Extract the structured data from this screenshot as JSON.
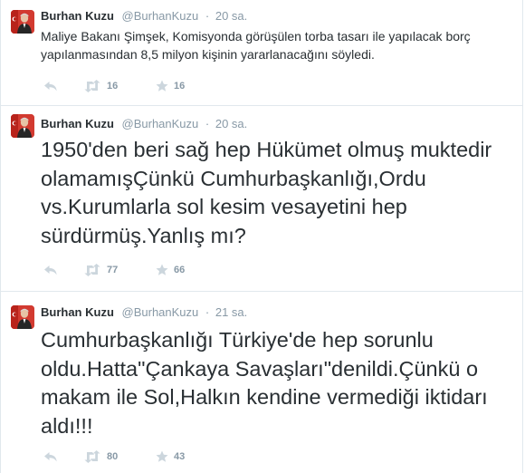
{
  "tweets": [
    {
      "fullname": "Burhan Kuzu",
      "username": "@BurhanKuzu",
      "separator": "·",
      "time": "20 sa.",
      "text": "Maliye Bakanı Şimşek, Komisyonda görüşülen torba tasarı ile yapılacak borç yapılanmasından 8,5 milyon kişinin yararlanacağını söyledi.",
      "retweets": "16",
      "favorites": "16"
    },
    {
      "fullname": "Burhan Kuzu",
      "username": "@BurhanKuzu",
      "separator": "·",
      "time": "20 sa.",
      "text": "1950'den beri sağ hep Hükümet olmuş muktedir olamamışÇünkü Cumhurbaşkanlığı,Ordu vs.Kurumlarla sol kesim vesayetini hep sürdürmüş.Yanlış mı?",
      "retweets": "77",
      "favorites": "66"
    },
    {
      "fullname": "Burhan Kuzu",
      "username": "@BurhanKuzu",
      "separator": "·",
      "time": "21 sa.",
      "text": "Cumhurbaşkanlığı Türkiye'de hep sorunlu oldu.Hatta\"Çankaya Savaşları\"denildi.Çünkü o makam ile Sol,Halkın kendine vermediği iktidarı aldı!!!",
      "retweets": "80",
      "favorites": "43"
    }
  ],
  "colors": {
    "text": "#292f33",
    "muted": "#8899a6",
    "icon": "#ccd6dd",
    "divider": "#e1e8ed",
    "avatar_bg": "#c94036"
  },
  "icons": {
    "reply": "reply-icon",
    "retweet": "retweet-icon",
    "favorite": "favorite-star-icon",
    "avatar": "profile-photo-with-turkish-flag"
  }
}
